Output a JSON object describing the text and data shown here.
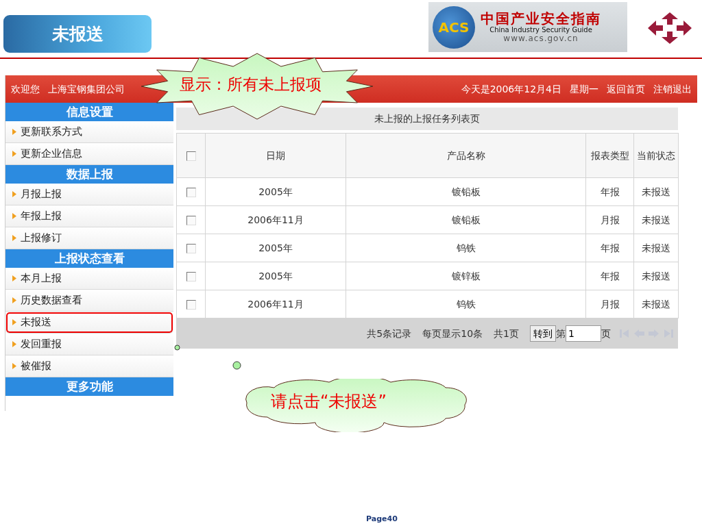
{
  "title": "未报送",
  "logo": {
    "badge": "ACS",
    "title_cn": "中国产业安全指南",
    "title_en": "China Industry Security Guide",
    "url": "www.acs.gov.cn"
  },
  "app": {
    "welcome": "欢迎您",
    "company": "上海宝钢集团公司",
    "date": "今天是2006年12月4日",
    "weekday": "星期一",
    "links": [
      "返回首页",
      "注销退出"
    ],
    "sidebar": [
      {
        "heading": "信息设置",
        "items": [
          {
            "label": "更新联系方式",
            "highlighted": false
          },
          {
            "label": "更新企业信息",
            "highlighted": false
          }
        ]
      },
      {
        "heading": "数据上报",
        "items": [
          {
            "label": "月报上报",
            "highlighted": false
          },
          {
            "label": "年报上报",
            "highlighted": false
          },
          {
            "label": "上报修订",
            "highlighted": false
          }
        ]
      },
      {
        "heading": "上报状态查看",
        "items": [
          {
            "label": "本月上报",
            "highlighted": false
          },
          {
            "label": "历史数据查看",
            "highlighted": false
          },
          {
            "label": "未报送",
            "highlighted": true
          },
          {
            "label": "发回重报",
            "highlighted": false
          },
          {
            "label": "被催报",
            "highlighted": false
          }
        ]
      },
      {
        "heading": "更多功能"
      }
    ],
    "table": {
      "caption": "未上报的上报任务列表页",
      "header_checked": false,
      "columns": [
        "日期",
        "产品名称",
        "报表类型",
        "当前状态"
      ],
      "rows": [
        {
          "checked": false,
          "cells": [
            "2005年",
            "镀铅板",
            "年报",
            "未报送"
          ]
        },
        {
          "checked": false,
          "cells": [
            "2006年11月",
            "镀铅板",
            "月报",
            "未报送"
          ]
        },
        {
          "checked": false,
          "cells": [
            "2005年",
            "钨铁",
            "年报",
            "未报送"
          ]
        },
        {
          "checked": false,
          "cells": [
            "2005年",
            "镀锌板",
            "年报",
            "未报送"
          ]
        },
        {
          "checked": false,
          "cells": [
            "2006年11月",
            "钨铁",
            "月报",
            "未报送"
          ]
        }
      ]
    },
    "pager": {
      "records": "共5条记录",
      "per_page": "每页显示10条",
      "pages": "共1页",
      "goto": "转到",
      "prefix": "第",
      "page": "1",
      "suffix": "页"
    }
  },
  "callouts": [
    {
      "kind": "starburst",
      "text": "显示：所有未上报项"
    },
    {
      "kind": "cloud",
      "text": "请点击“未报送”"
    }
  ],
  "page": "Page40"
}
